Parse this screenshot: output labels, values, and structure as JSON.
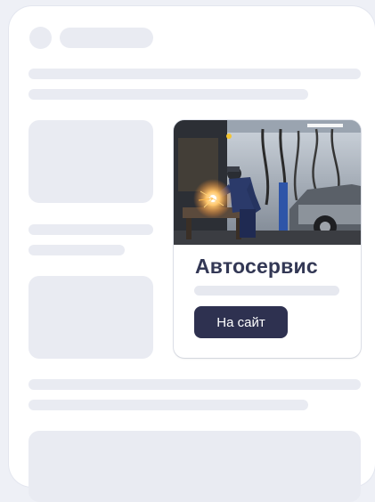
{
  "ad": {
    "title": "Автосервис",
    "button_label": "На сайт",
    "image": "auto-repair-workshop-photo"
  },
  "colors": {
    "background": "#eef0f6",
    "skeleton": "#e9ebf2",
    "button": "#2e3150",
    "title": "#333855"
  }
}
